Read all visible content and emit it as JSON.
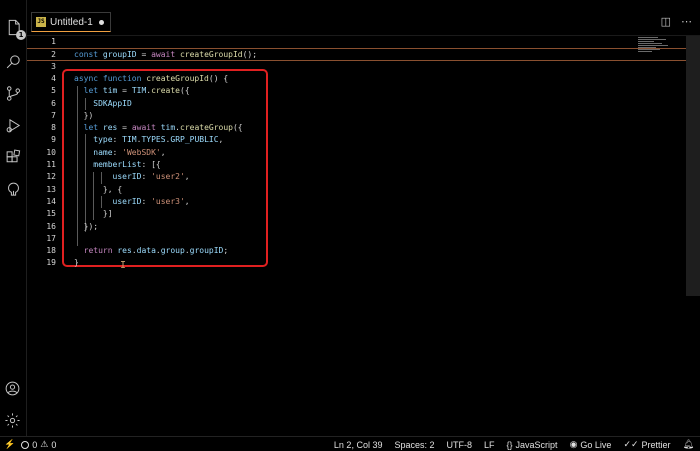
{
  "tab": {
    "label": "Untitled-1",
    "file_icon": "JS"
  },
  "editor": {
    "lines": [
      {
        "n": "1",
        "tokens": []
      },
      {
        "n": "2",
        "tokens": [
          [
            "kw",
            "const "
          ],
          [
            "var",
            "groupID"
          ],
          [
            "pl",
            " = "
          ],
          [
            "kwc",
            "await "
          ],
          [
            "fn",
            "createGroupId"
          ],
          [
            "pl",
            "();"
          ]
        ]
      },
      {
        "n": "3",
        "tokens": []
      },
      {
        "n": "4",
        "tokens": [
          [
            "kw",
            "async function "
          ],
          [
            "fn",
            "createGroupId"
          ],
          [
            "pl",
            "() {"
          ]
        ]
      },
      {
        "n": "5",
        "tokens": [
          [
            "pl",
            "  "
          ],
          [
            "kw",
            "let "
          ],
          [
            "var",
            "tim"
          ],
          [
            "pl",
            " = "
          ],
          [
            "var",
            "TIM"
          ],
          [
            "pl",
            "."
          ],
          [
            "fn",
            "create"
          ],
          [
            "pl",
            "({"
          ]
        ]
      },
      {
        "n": "6",
        "tokens": [
          [
            "pl",
            "    "
          ],
          [
            "var",
            "SDKAppID"
          ]
        ]
      },
      {
        "n": "7",
        "tokens": [
          [
            "pl",
            "  })"
          ]
        ]
      },
      {
        "n": "8",
        "tokens": [
          [
            "pl",
            "  "
          ],
          [
            "kw",
            "let "
          ],
          [
            "var",
            "res"
          ],
          [
            "pl",
            " = "
          ],
          [
            "kwc",
            "await "
          ],
          [
            "var",
            "tim"
          ],
          [
            "pl",
            "."
          ],
          [
            "fn",
            "createGroup"
          ],
          [
            "pl",
            "({"
          ]
        ]
      },
      {
        "n": "9",
        "tokens": [
          [
            "pl",
            "    "
          ],
          [
            "var",
            "type"
          ],
          [
            "pl",
            ": "
          ],
          [
            "var",
            "TIM"
          ],
          [
            "pl",
            "."
          ],
          [
            "var",
            "TYPES"
          ],
          [
            "pl",
            "."
          ],
          [
            "var",
            "GRP_PUBLIC"
          ],
          [
            "pl",
            ","
          ]
        ]
      },
      {
        "n": "10",
        "tokens": [
          [
            "pl",
            "    "
          ],
          [
            "var",
            "name"
          ],
          [
            "pl",
            ": "
          ],
          [
            "str",
            "'WebSDK'"
          ],
          [
            "pl",
            ","
          ]
        ]
      },
      {
        "n": "11",
        "tokens": [
          [
            "pl",
            "    "
          ],
          [
            "var",
            "memberList"
          ],
          [
            "pl",
            ": [{"
          ]
        ]
      },
      {
        "n": "12",
        "tokens": [
          [
            "pl",
            "        "
          ],
          [
            "var",
            "userID"
          ],
          [
            "pl",
            ": "
          ],
          [
            "str",
            "'user2'"
          ],
          [
            "pl",
            ","
          ]
        ]
      },
      {
        "n": "13",
        "tokens": [
          [
            "pl",
            "      }, {"
          ]
        ]
      },
      {
        "n": "14",
        "tokens": [
          [
            "pl",
            "        "
          ],
          [
            "var",
            "userID"
          ],
          [
            "pl",
            ": "
          ],
          [
            "str",
            "'user3'"
          ],
          [
            "pl",
            ","
          ]
        ]
      },
      {
        "n": "15",
        "tokens": [
          [
            "pl",
            "      }]"
          ]
        ]
      },
      {
        "n": "16",
        "tokens": [
          [
            "pl",
            "  });"
          ]
        ]
      },
      {
        "n": "17",
        "tokens": []
      },
      {
        "n": "18",
        "tokens": [
          [
            "pl",
            "  "
          ],
          [
            "kwc",
            "return "
          ],
          [
            "var",
            "res"
          ],
          [
            "pl",
            "."
          ],
          [
            "var",
            "data"
          ],
          [
            "pl",
            "."
          ],
          [
            "var",
            "group"
          ],
          [
            "pl",
            "."
          ],
          [
            "var",
            "groupID"
          ],
          [
            "pl",
            ";"
          ]
        ]
      },
      {
        "n": "19",
        "tokens": [
          [
            "pl",
            "}"
          ]
        ]
      }
    ]
  },
  "activity": {
    "badge_count": "1"
  },
  "status": {
    "errors": "0",
    "warnings": "0",
    "position": "Ln 2, Col 39",
    "spaces": "Spaces: 2",
    "encoding": "UTF-8",
    "eol": "LF",
    "language": "JavaScript",
    "golive": "Go Live",
    "prettier": "Prettier"
  },
  "colors": {
    "highlight_box": "#e02020",
    "tab_accent": "#f0a040"
  }
}
